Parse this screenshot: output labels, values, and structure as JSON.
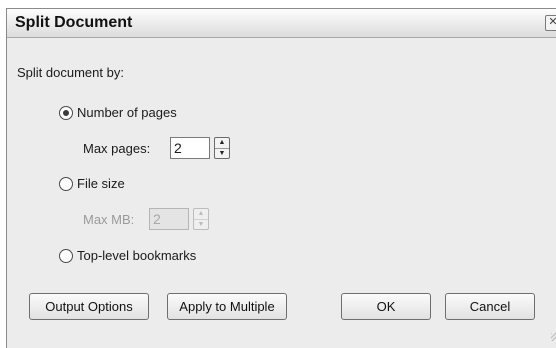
{
  "dialog": {
    "title": "Split Document",
    "close_icon": "close-icon",
    "section_label": "Split document by:",
    "options": {
      "pages": {
        "label": "Number of pages",
        "selected": true,
        "field_label": "Max pages:",
        "value": "2"
      },
      "filesize": {
        "label": "File size",
        "selected": false,
        "field_label": "Max MB:",
        "value": "2"
      },
      "bookmarks": {
        "label": "Top-level bookmarks",
        "selected": false
      }
    },
    "buttons": {
      "output_options": "Output Options",
      "apply_multiple": "Apply to Multiple",
      "ok": "OK",
      "cancel": "Cancel"
    }
  }
}
